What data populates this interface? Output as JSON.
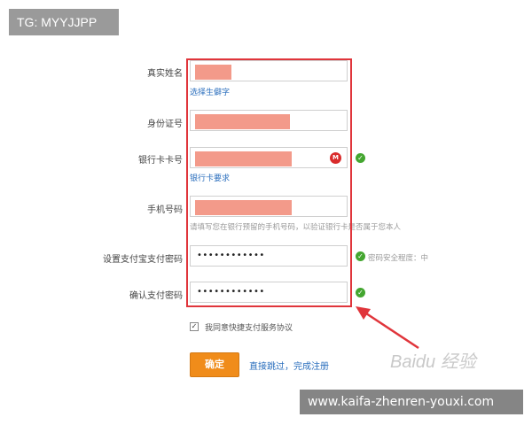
{
  "overlay": {
    "tg_text": "TG: MYYJJPP",
    "site_banner": "www.kaifa-zhenren-youxi.com",
    "watermark": "Baidu 经验"
  },
  "form": {
    "fields": [
      {
        "label": "真实姓名",
        "hint_link": "选择生僻字"
      },
      {
        "label": "身份证号"
      },
      {
        "label": "银行卡卡号",
        "hint_link": "银行卡要求"
      },
      {
        "label": "手机号码",
        "hint_text": "请填写您在银行预留的手机号码，以验证银行卡是否属于您本人"
      },
      {
        "label": "设置支付宝支付密码",
        "value": "••••••••••••",
        "hint_text": "密码安全程度：中"
      },
      {
        "label": "确认支付密码",
        "value": "••••••••••••"
      }
    ],
    "agree_checked": true,
    "agree_label": "我同意快捷支付服务协议",
    "confirm_label": "确定",
    "skip_label": "直接跳过，完成注册"
  },
  "icons": {
    "check": "check-circle-icon",
    "bank": "bank-logo-icon",
    "checkmark": "✓",
    "bank_glyph": "M"
  },
  "colors": {
    "highlight": "#e0353b",
    "redaction": "#f39a8a",
    "button": "#f08c1a",
    "link": "#2a6ebd",
    "success": "#44a630"
  }
}
